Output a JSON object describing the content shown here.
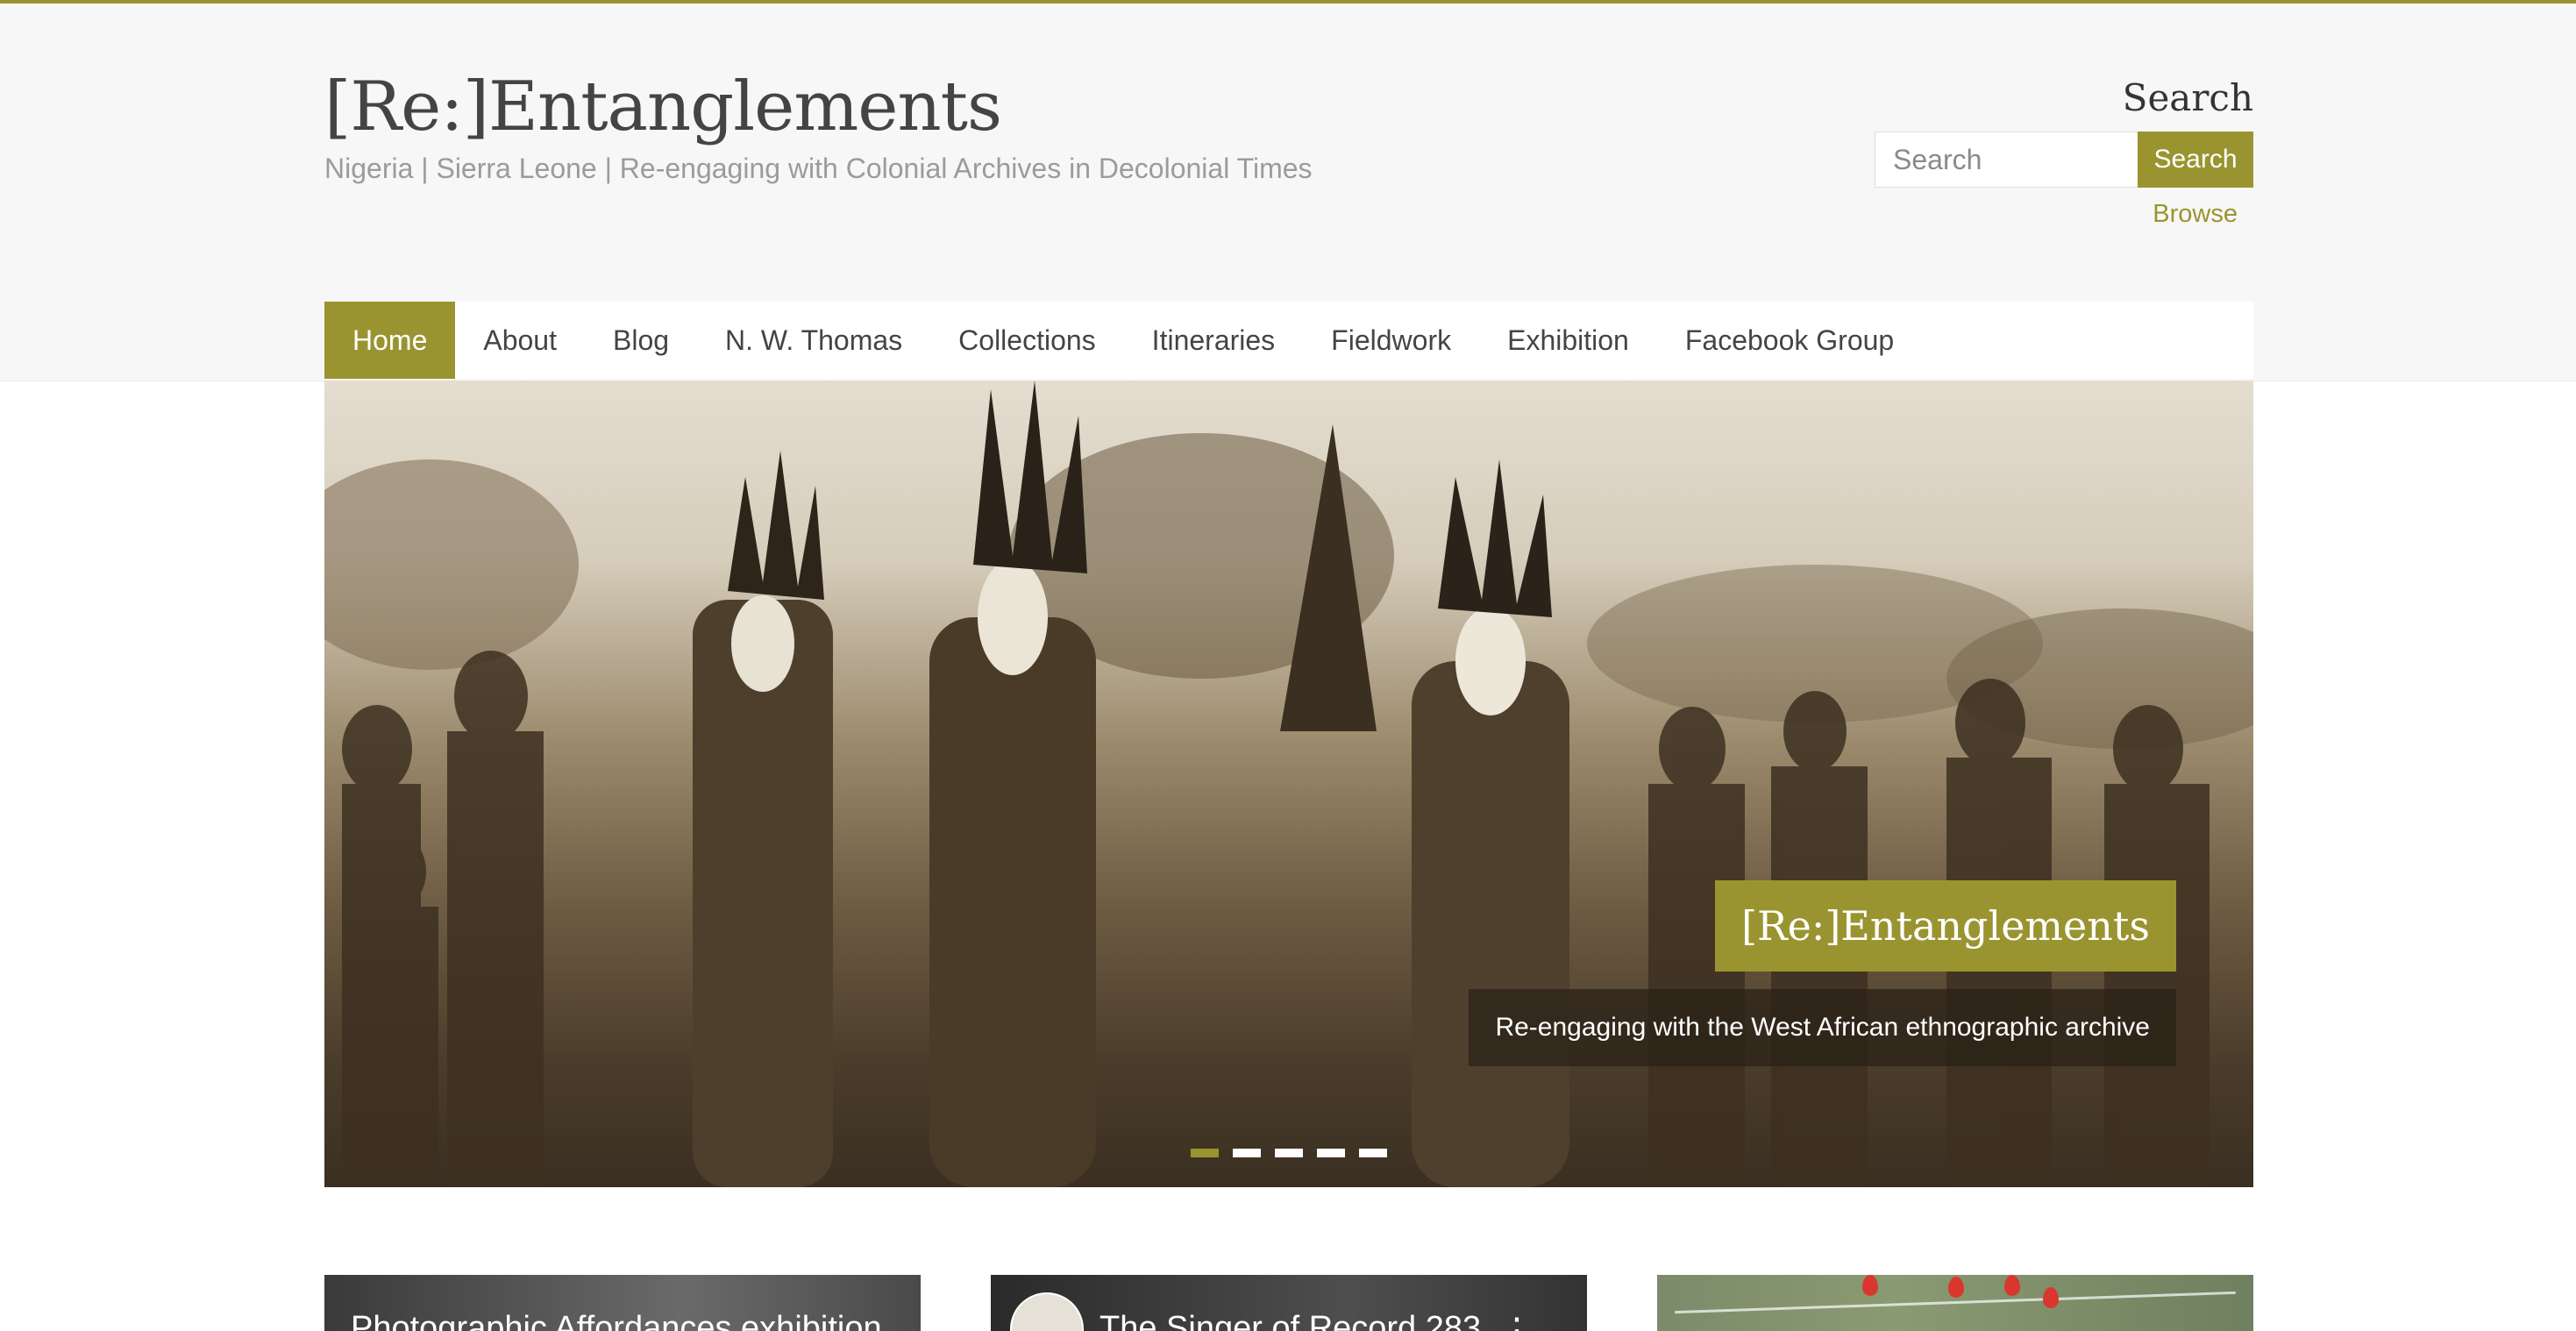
{
  "site": {
    "title": "[Re:]Entanglements",
    "tagline": "Nigeria | Sierra Leone | Re-engaging with Colonial Archives in Decolonial Times"
  },
  "search": {
    "heading": "Search",
    "placeholder": "Search",
    "button_label": "Search",
    "browse_label": "Browse"
  },
  "nav": {
    "items": [
      {
        "label": "Home",
        "active": true
      },
      {
        "label": "About",
        "active": false
      },
      {
        "label": "Blog",
        "active": false
      },
      {
        "label": "N. W. Thomas",
        "active": false
      },
      {
        "label": "Collections",
        "active": false
      },
      {
        "label": "Itineraries",
        "active": false
      },
      {
        "label": "Fieldwork",
        "active": false
      },
      {
        "label": "Exhibition",
        "active": false
      },
      {
        "label": "Facebook Group",
        "active": false
      }
    ]
  },
  "hero": {
    "caption_title": "[Re:]Entanglements",
    "caption_text": "Re-engaging with the West African ethnographic archive",
    "slide_count": 5,
    "active_slide": 1
  },
  "cards": [
    {
      "title": "Photographic Affordances exhibition"
    },
    {
      "title": "The Singer of Record 283"
    },
    {
      "title": ""
    }
  ],
  "colors": {
    "accent": "#9a9430",
    "header_background": "#f7f7f7",
    "text": "#444444",
    "muted_text": "#9b9b9b"
  }
}
